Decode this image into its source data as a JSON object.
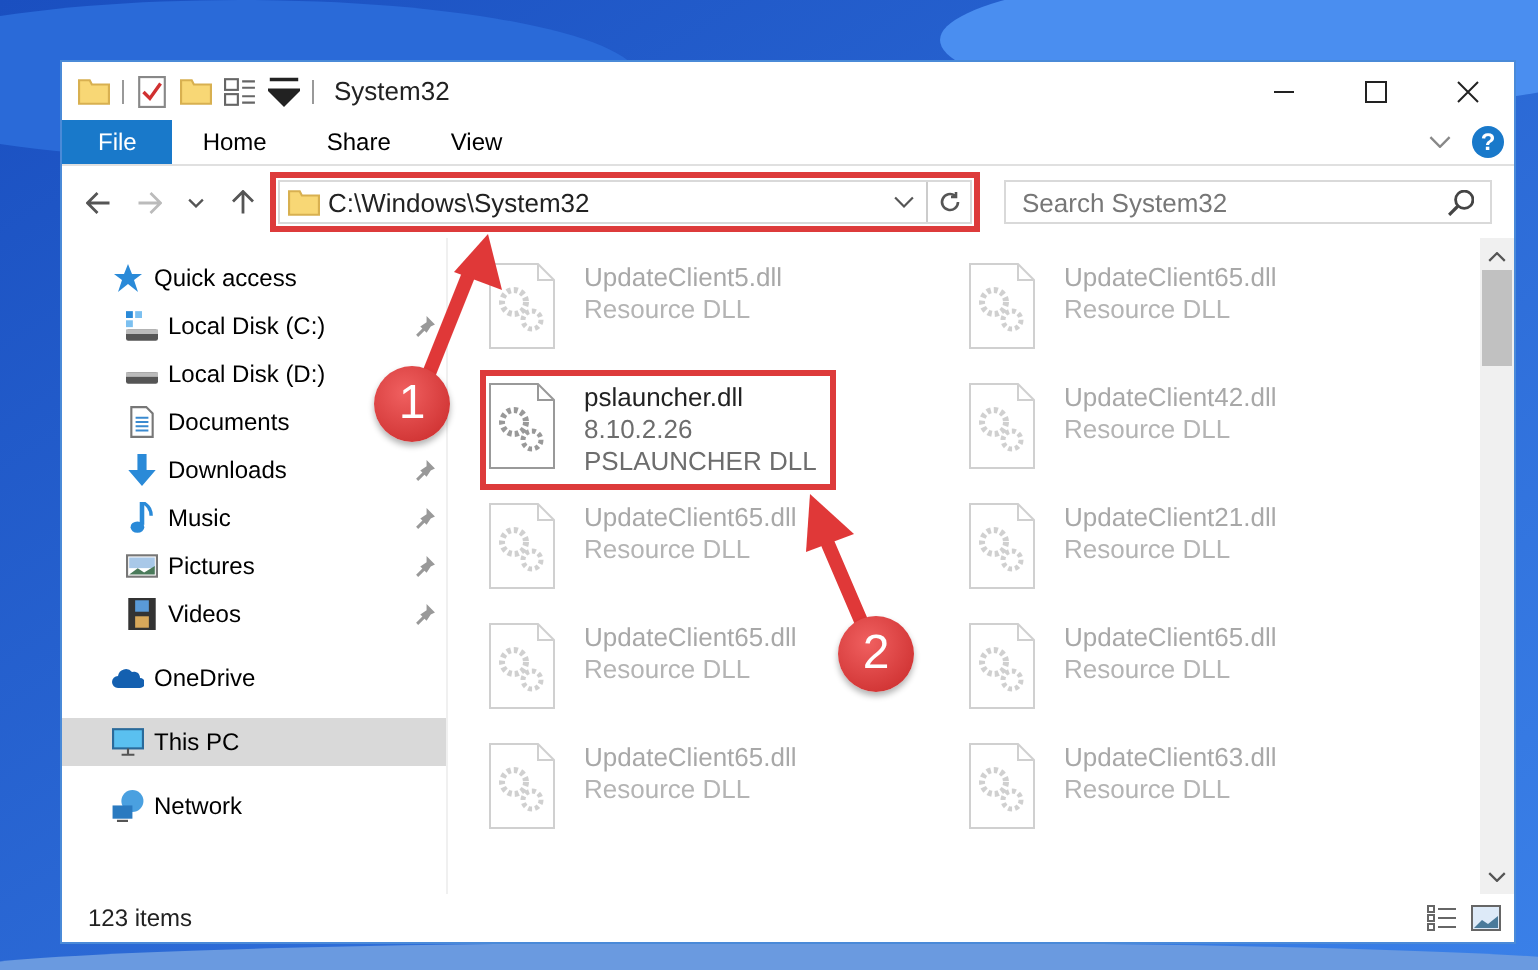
{
  "window": {
    "title": "System32"
  },
  "ribbon": {
    "tabs": [
      {
        "label": "File",
        "kind": "file"
      },
      {
        "label": "Home",
        "kind": "tab"
      },
      {
        "label": "Share",
        "kind": "tab"
      },
      {
        "label": "View",
        "kind": "tab"
      }
    ],
    "help": "?"
  },
  "address_bar": {
    "path": "C:\\Windows\\System32",
    "highlighted": true
  },
  "search": {
    "placeholder": "Search System32"
  },
  "sidebar": {
    "items": [
      {
        "label": "Quick access",
        "kind": "star",
        "selected": false,
        "children": [
          {
            "label": "Local Disk (C:)",
            "kind": "drive-c",
            "pinned": true
          },
          {
            "label": "Local Disk (D:)",
            "kind": "drive",
            "pinned": false
          },
          {
            "label": "Documents",
            "kind": "document",
            "pinned": false
          },
          {
            "label": "Downloads",
            "kind": "download",
            "pinned": true
          },
          {
            "label": "Music",
            "kind": "music",
            "pinned": true
          },
          {
            "label": "Pictures",
            "kind": "pictures",
            "pinned": true
          },
          {
            "label": "Videos",
            "kind": "videos",
            "pinned": true
          }
        ]
      },
      {
        "label": "OneDrive",
        "kind": "cloud",
        "selected": false
      },
      {
        "label": "This PC",
        "kind": "pc",
        "selected": true
      },
      {
        "label": "Network",
        "kind": "network",
        "selected": false
      }
    ]
  },
  "files": [
    {
      "name": "UpdateClient5.dll",
      "details": [
        "Resource DLL"
      ],
      "dimmed": true,
      "highlighted": false
    },
    {
      "name": "UpdateClient65.dll",
      "details": [
        "Resource DLL"
      ],
      "dimmed": true,
      "highlighted": false
    },
    {
      "name": "pslauncher.dll",
      "details": [
        "8.10.2.26",
        "PSLAUNCHER DLL"
      ],
      "dimmed": false,
      "highlighted": true
    },
    {
      "name": "UpdateClient42.dll",
      "details": [
        "Resource DLL"
      ],
      "dimmed": true,
      "highlighted": false
    },
    {
      "name": "UpdateClient65.dll",
      "details": [
        "Resource DLL"
      ],
      "dimmed": true,
      "highlighted": false
    },
    {
      "name": "UpdateClient21.dll",
      "details": [
        "Resource DLL"
      ],
      "dimmed": true,
      "highlighted": false
    },
    {
      "name": "UpdateClient65.dll",
      "details": [
        "Resource DLL"
      ],
      "dimmed": true,
      "highlighted": false
    },
    {
      "name": "UpdateClient65.dll",
      "details": [
        "Resource DLL"
      ],
      "dimmed": true,
      "highlighted": false
    },
    {
      "name": "UpdateClient65.dll",
      "details": [
        "Resource DLL"
      ],
      "dimmed": true,
      "highlighted": false
    },
    {
      "name": "UpdateClient63.dll",
      "details": [
        "Resource DLL"
      ],
      "dimmed": true,
      "highlighted": false
    }
  ],
  "status_bar": {
    "item_count": "123 items"
  },
  "annotations": [
    {
      "number": "1"
    },
    {
      "number": "2"
    }
  ]
}
